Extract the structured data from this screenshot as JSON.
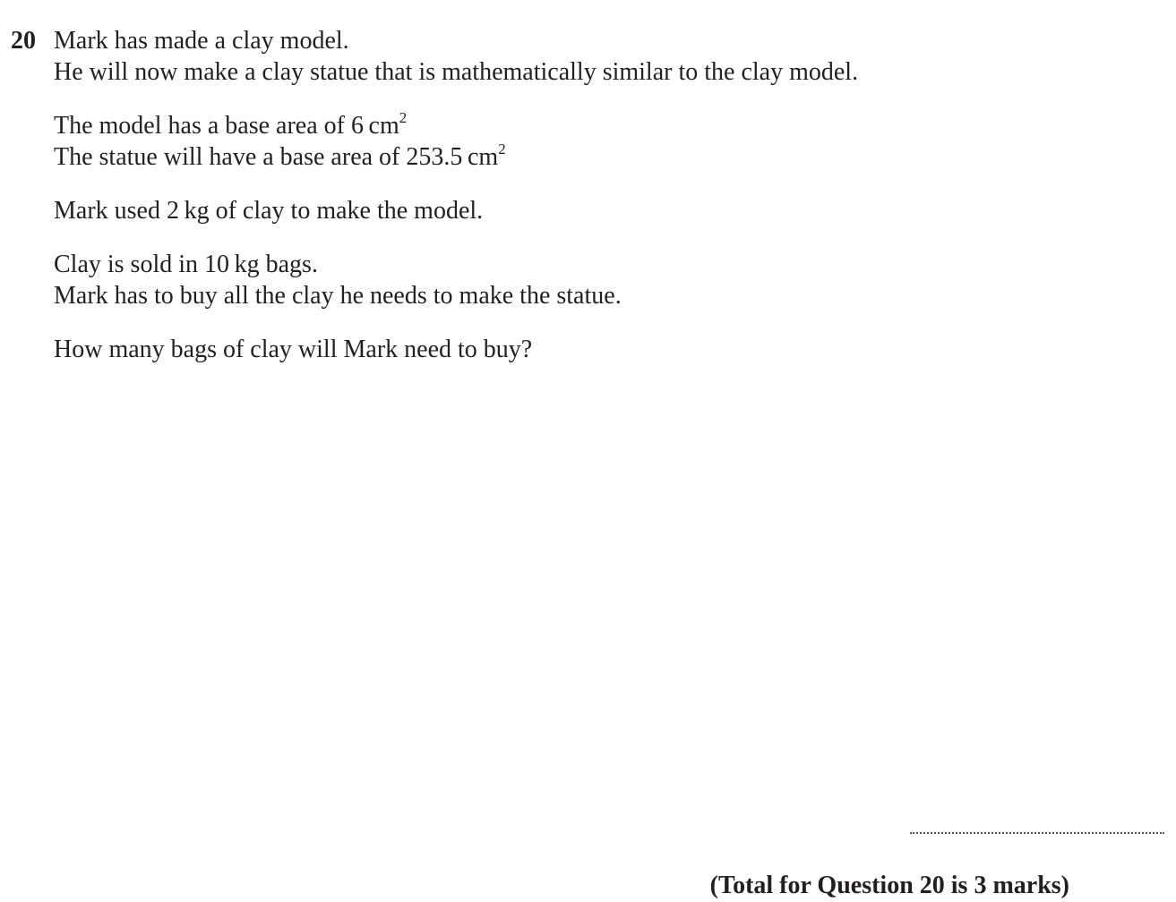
{
  "question": {
    "number": "20",
    "paragraphs": [
      [
        "Mark has made a clay model.",
        "He will now make a clay statue that is mathematically similar to the clay model."
      ],
      [
        "The model has a base area of 6 cm",
        "The statue will have a base area of 253.5 cm"
      ],
      [
        "Mark used 2 kg of clay to make the model."
      ],
      [
        "Clay is sold in 10 kg bags.",
        "Mark has to buy all the clay he needs to make the statue."
      ],
      [
        "How many bags of clay will Mark need to buy?"
      ]
    ],
    "superscript": "2",
    "total": "(Total for Question 20 is 3 marks)"
  }
}
